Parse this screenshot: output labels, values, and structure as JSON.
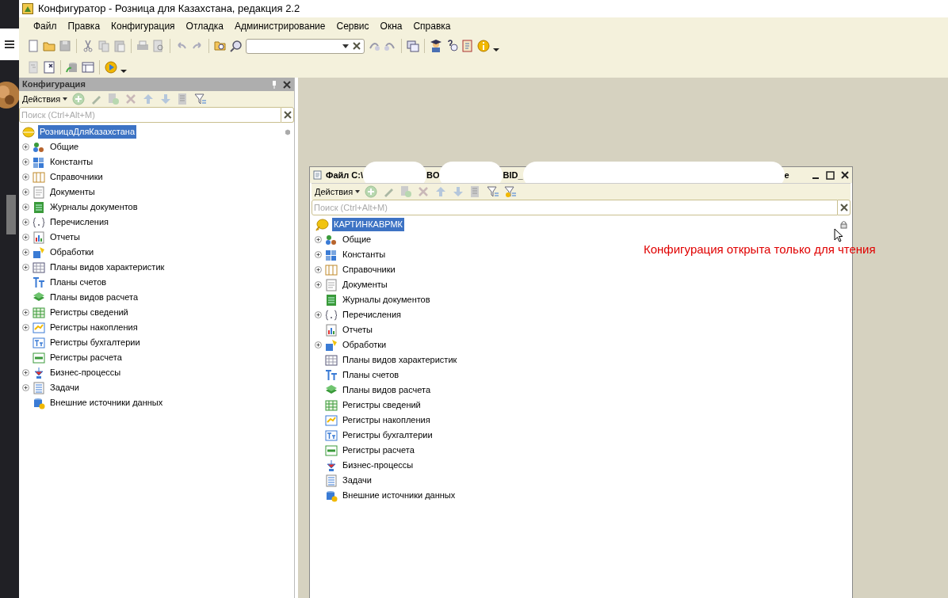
{
  "window": {
    "title": "Конфигуратор - Розница для Казахстана, редакция 2.2"
  },
  "menu": [
    "Файл",
    "Правка",
    "Конфигурация",
    "Отладка",
    "Администрирование",
    "Сервис",
    "Окна",
    "Справка"
  ],
  "config_panel": {
    "title": "Конфигурация",
    "actions": "Действия",
    "search": {
      "placeholder": "Поиск (Ctrl+Alt+M)"
    },
    "root": {
      "label": "РозницаДляКазахстана",
      "selected": true
    },
    "items": [
      {
        "label": "Общие",
        "expandable": true
      },
      {
        "label": "Константы",
        "expandable": true
      },
      {
        "label": "Справочники",
        "expandable": true
      },
      {
        "label": "Документы",
        "expandable": true
      },
      {
        "label": "Журналы документов",
        "expandable": true
      },
      {
        "label": "Перечисления",
        "expandable": true
      },
      {
        "label": "Отчеты",
        "expandable": true
      },
      {
        "label": "Обработки",
        "expandable": true
      },
      {
        "label": "Планы видов характеристик",
        "expandable": true
      },
      {
        "label": "Планы счетов",
        "expandable": false
      },
      {
        "label": "Планы видов расчета",
        "expandable": false
      },
      {
        "label": "Регистры сведений",
        "expandable": true
      },
      {
        "label": "Регистры накопления",
        "expandable": true
      },
      {
        "label": "Регистры бухгалтерии",
        "expandable": false
      },
      {
        "label": "Регистры расчета",
        "expandable": false
      },
      {
        "label": "Бизнес-процессы",
        "expandable": true
      },
      {
        "label": "Задачи",
        "expandable": true
      },
      {
        "label": "Внешние источники данных",
        "expandable": false
      }
    ]
  },
  "file_window": {
    "title_parts": [
      "Файл C:\\",
      "BO",
      "BID_",
      "е"
    ],
    "actions": "Действия",
    "search": {
      "placeholder": "Поиск (Ctrl+Alt+M)"
    },
    "root": {
      "label": "КАРТИНКАВРМК",
      "selected": true
    },
    "items": [
      {
        "label": "Общие",
        "expandable": true
      },
      {
        "label": "Константы",
        "expandable": true
      },
      {
        "label": "Справочники",
        "expandable": true
      },
      {
        "label": "Документы",
        "expandable": true
      },
      {
        "label": "Журналы документов",
        "expandable": false
      },
      {
        "label": "Перечисления",
        "expandable": true
      },
      {
        "label": "Отчеты",
        "expandable": false
      },
      {
        "label": "Обработки",
        "expandable": true
      },
      {
        "label": "Планы видов характеристик",
        "expandable": false
      },
      {
        "label": "Планы счетов",
        "expandable": false
      },
      {
        "label": "Планы видов расчета",
        "expandable": false
      },
      {
        "label": "Регистры сведений",
        "expandable": false
      },
      {
        "label": "Регистры накопления",
        "expandable": false
      },
      {
        "label": "Регистры бухгалтерии",
        "expandable": false
      },
      {
        "label": "Регистры расчета",
        "expandable": false
      },
      {
        "label": "Бизнес-процессы",
        "expandable": false
      },
      {
        "label": "Задачи",
        "expandable": false
      },
      {
        "label": "Внешние источники данных",
        "expandable": false
      }
    ]
  },
  "annotation": "Конфигурация открыта только для чтения"
}
